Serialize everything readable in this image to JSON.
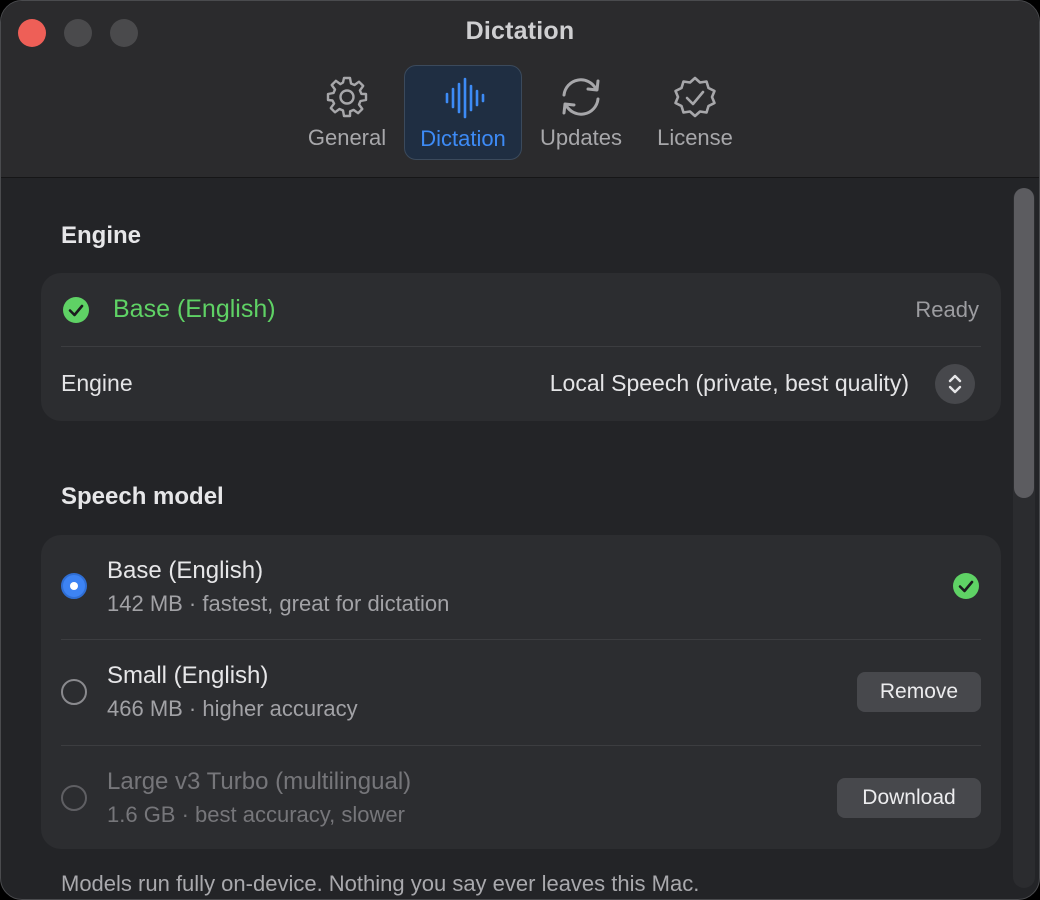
{
  "window": {
    "title": "Dictation"
  },
  "tabs": [
    {
      "label": "General",
      "icon": "gear-icon"
    },
    {
      "label": "Dictation",
      "icon": "waveform-icon",
      "active": true
    },
    {
      "label": "Updates",
      "icon": "sync-icon"
    },
    {
      "label": "License",
      "icon": "badge-check-icon"
    }
  ],
  "engine_section": {
    "title": "Engine",
    "status_label": "Base (English)",
    "status_text": "Ready",
    "engine_label": "Engine",
    "engine_value": "Local Speech (private, best quality)"
  },
  "speech_model": {
    "title": "Speech model",
    "models": [
      {
        "name": "Base (English)",
        "description": "142 MB · fastest, great for dictation",
        "selected": true,
        "installed": true
      },
      {
        "name": "Small (English)",
        "description": "466 MB · higher accuracy",
        "action": "Remove"
      },
      {
        "name": "Large v3 Turbo (multilingual)",
        "description": "1.6 GB · best accuracy, slower",
        "action": "Download"
      }
    ]
  },
  "footer_note": "Models run fully on-device. Nothing you say ever leaves this Mac.",
  "colors": {
    "accent": "#3d8bf6",
    "success": "#5fd265",
    "close": "#ee5f57"
  }
}
